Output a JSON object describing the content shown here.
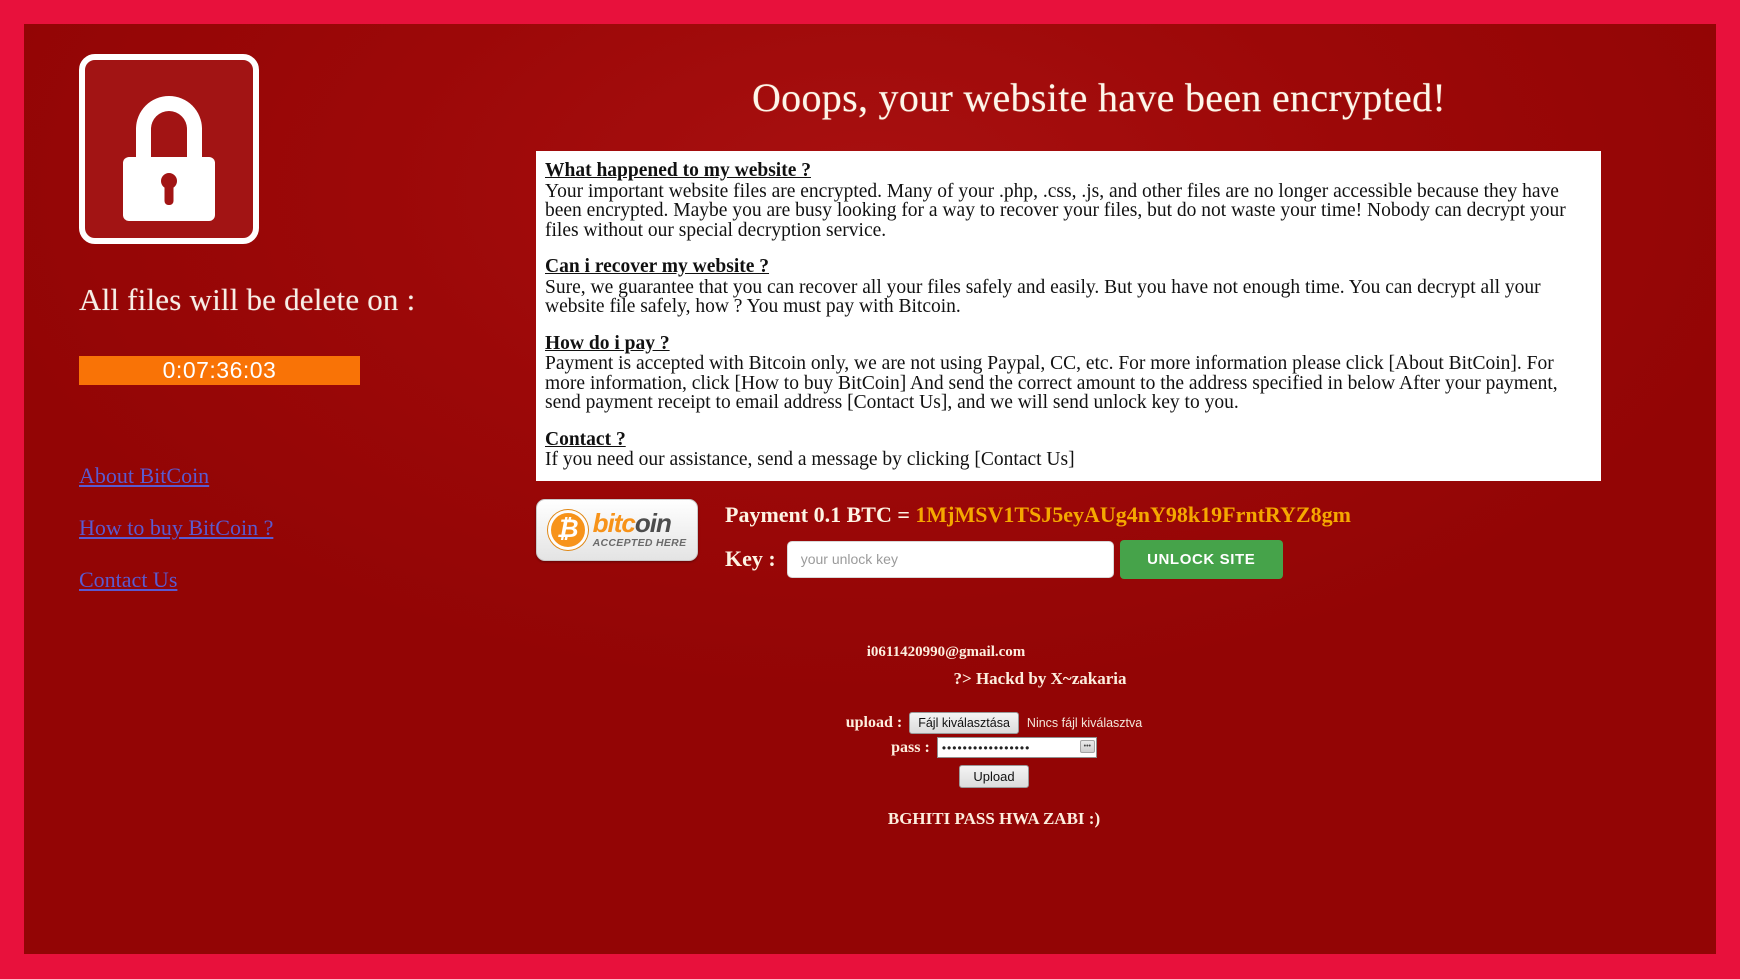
{
  "headline": "Ooops, your website have been encrypted!",
  "sidebar": {
    "lock_icon": "padlock-icon",
    "delete_notice": "All files will be delete on :",
    "timer": "0:07:36:03",
    "links": [
      {
        "label": "About BitCoin"
      },
      {
        "label": "How to buy BitCoin ?"
      },
      {
        "label": "Contact Us"
      }
    ]
  },
  "info": {
    "sections": [
      {
        "heading": "What happened to my website ?",
        "body": "Your important website files are encrypted. Many of your .php, .css, .js, and other files are no longer accessible because they have been encrypted. Maybe you are busy looking for a way to recover your files, but do not waste your time! Nobody can decrypt your files without our special decryption service."
      },
      {
        "heading": "Can i recover my website ?",
        "body": "Sure, we guarantee that you can recover all your files safely and easily. But you have not enough time. You can decrypt all your website file safely, how ? You must pay with Bitcoin."
      },
      {
        "heading": "How do i pay ?",
        "body": "Payment is accepted with Bitcoin only, we are not using Paypal, CC, etc. For more information please click [About BitCoin]. For more information, click [How to buy BitCoin] And send the correct amount to the address specified in below After your payment, send payment receipt to email address [Contact Us], and we will send unlock key to you."
      },
      {
        "heading": "Contact ?",
        "body": "If you need our assistance, send a message by clicking [Contact Us]"
      }
    ]
  },
  "payment": {
    "badge": {
      "symbol": "₿",
      "name_part1": "bitc",
      "name_part2": "oin",
      "subtitle": "ACCEPTED HERE"
    },
    "amount_label": "Payment 0.1 BTC = ",
    "address": "1MjMSV1TSJ5eyAUg4nY98k19FrntRYZ8gm",
    "key_label": "Key :",
    "key_placeholder": "your unlock key",
    "key_value": "",
    "unlock_label": "UNLOCK SITE",
    "accent_address_color": "#f5a800",
    "unlock_button_color": "#46a34a"
  },
  "footer": {
    "email": "i0611420990@gmail.com",
    "signature": "?> Hackd by X~zakaria",
    "upload_label": "upload :",
    "file_button": "Fájl kiválasztása",
    "file_status": "Nincs fájl kiválasztva",
    "pass_label": "pass :",
    "pass_value": "•••••••••••••••••",
    "upload_button": "Upload",
    "bottom_note": "BGHITI PASS HWA ZABI :)"
  }
}
